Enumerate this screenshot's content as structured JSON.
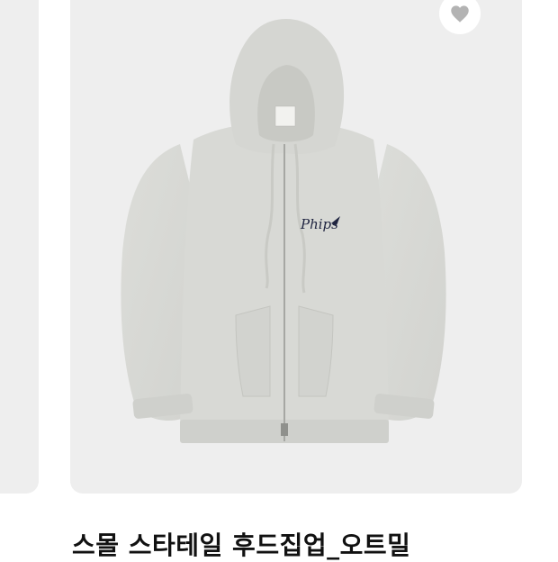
{
  "product": {
    "name": "스몰 스타테일 후드집업_오트밀",
    "logo_text": "Phips",
    "colors": {
      "card_bg": "#eeeeee",
      "fabric": "#d9dad6",
      "logo": "#1f2440"
    },
    "like_icon": "heart-icon"
  }
}
